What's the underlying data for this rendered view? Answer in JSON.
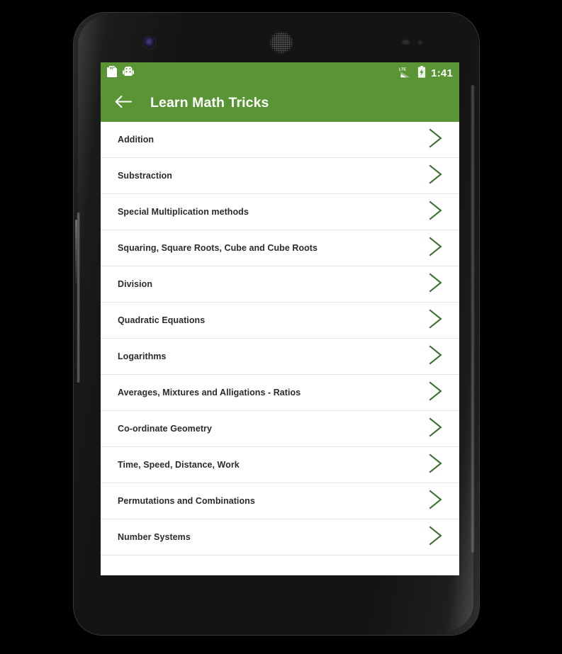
{
  "device": {
    "hardware": {
      "front_camera": "front-camera-lens",
      "earpiece": "earpiece-speaker-grille",
      "proximity_sensor": "proximity-sensor",
      "light_sensor": "ambient-light-sensor"
    }
  },
  "status_bar": {
    "background_color": "#599534",
    "left_icons": [
      {
        "name": "sd-card-icon",
        "label": "SD card"
      },
      {
        "name": "android-robot-icon",
        "label": "Android system"
      }
    ],
    "right_icons": [
      {
        "name": "lte-signal-icon",
        "label": "LTE"
      },
      {
        "name": "battery-charging-icon",
        "label": "Battery charging"
      }
    ],
    "clock": "1:41"
  },
  "app_bar": {
    "background_color": "#599534",
    "back_icon": "back-arrow-icon",
    "title": "Learn Math Tricks"
  },
  "list": {
    "chevron_icon": "chevron-right-icon",
    "chevron_color": "#3f7034",
    "items": [
      {
        "label": "Addition"
      },
      {
        "label": "Substraction"
      },
      {
        "label": "Special Multiplication methods"
      },
      {
        "label": "Squaring, Square Roots, Cube and Cube Roots"
      },
      {
        "label": "Division"
      },
      {
        "label": "Quadratic Equations"
      },
      {
        "label": "Logarithms"
      },
      {
        "label": "Averages, Mixtures and Alligations - Ratios"
      },
      {
        "label": "Co-ordinate Geometry"
      },
      {
        "label": "Time, Speed, Distance, Work"
      },
      {
        "label": "Permutations and Combinations"
      },
      {
        "label": "Number Systems"
      }
    ]
  }
}
